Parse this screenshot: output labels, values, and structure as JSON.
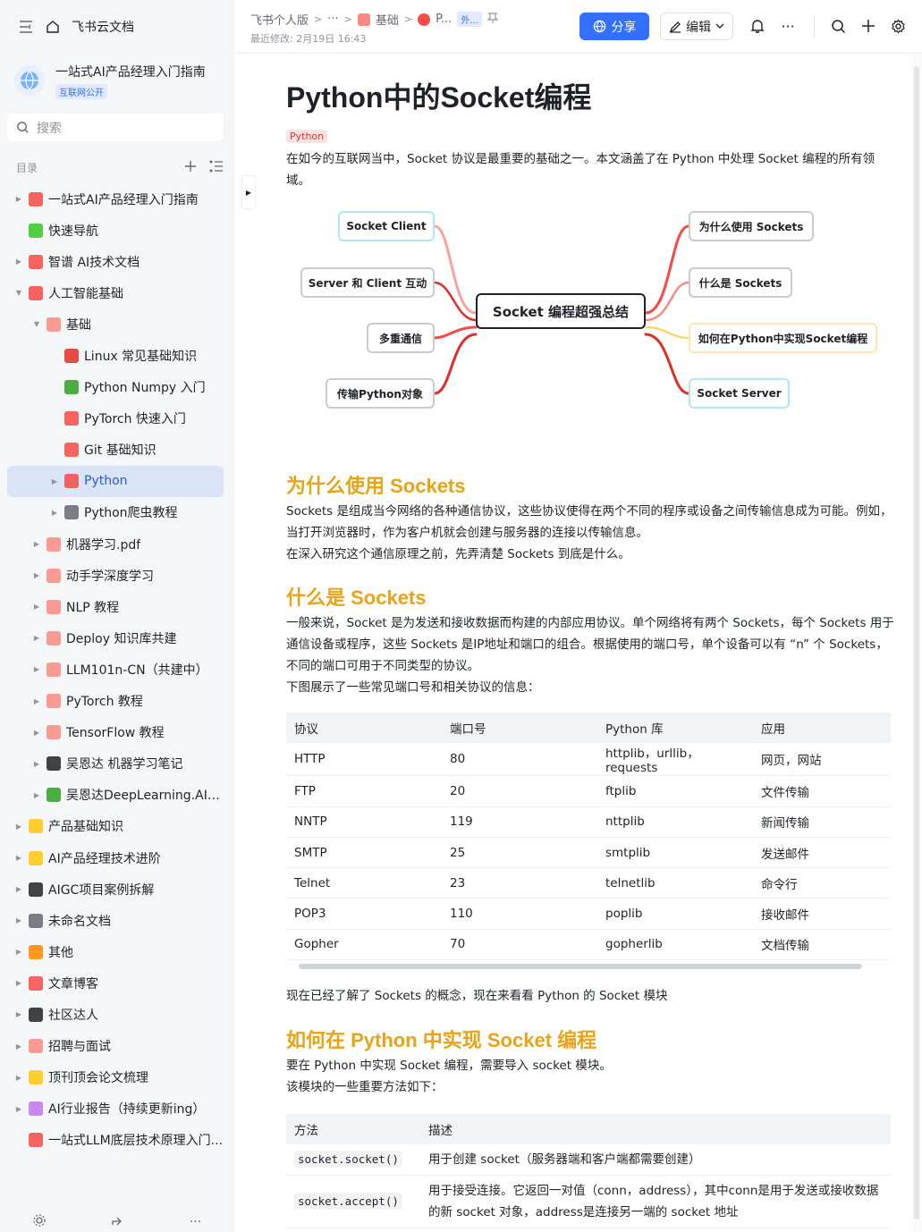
{
  "sidebar": {
    "home_label": "飞书云文档",
    "workspace_title": "一站式AI产品经理入门指南",
    "workspace_tag": "互联网公开",
    "search_placeholder": "搜索",
    "toc_label": "目录",
    "items": [
      {
        "label": "一站式AI产品经理入门指南",
        "level": 0,
        "arrow": "▶",
        "color": "#f54a45",
        "icon": "target-icon"
      },
      {
        "label": "快速导航",
        "level": 0,
        "arrow": "",
        "color": "#34c724",
        "icon": "compass-icon"
      },
      {
        "label": "智谱 AI技术文档",
        "level": 0,
        "arrow": "▶",
        "color": "#f54a45",
        "icon": "calendar-icon"
      },
      {
        "label": "人工智能基础",
        "level": 0,
        "arrow": "▼",
        "color": "#f54a45",
        "icon": "devil-icon"
      },
      {
        "label": "基础",
        "level": 1,
        "arrow": "▼",
        "color": "#f98981",
        "icon": "doc-icon"
      },
      {
        "label": "Linux 常见基础知识",
        "level": 2,
        "arrow": "",
        "color": "#e22e28",
        "icon": "apple-icon"
      },
      {
        "label": "Python Numpy 入门",
        "level": 2,
        "arrow": "",
        "color": "#2ea121",
        "icon": "refresh-icon"
      },
      {
        "label": "PyTorch 快速入门",
        "level": 2,
        "arrow": "",
        "color": "#f54a45",
        "icon": "devil-icon"
      },
      {
        "label": "Git 基础知识",
        "level": 2,
        "arrow": "",
        "color": "#f54a45",
        "icon": "devil-icon"
      },
      {
        "label": "Python",
        "level": 2,
        "arrow": "▶",
        "color": "#f54a45",
        "icon": "devil-icon",
        "active": true
      },
      {
        "label": "Python爬虫教程",
        "level": 2,
        "arrow": "▶",
        "color": "#646a73",
        "icon": "tools-icon"
      },
      {
        "label": "机器学习.pdf",
        "level": 1,
        "arrow": "▶",
        "color": "#f98981",
        "icon": "pdf-icon"
      },
      {
        "label": "动手学深度学习",
        "level": 1,
        "arrow": "▶",
        "color": "#f98981",
        "icon": "doc-icon"
      },
      {
        "label": "NLP 教程",
        "level": 1,
        "arrow": "▶",
        "color": "#f98981",
        "icon": "doc-icon"
      },
      {
        "label": "Deploy 知识库共建",
        "level": 1,
        "arrow": "▶",
        "color": "#f98981",
        "icon": "doc-icon"
      },
      {
        "label": "LLM101n-CN（共建中）",
        "level": 1,
        "arrow": "▶",
        "color": "#f98981",
        "icon": "doc-icon"
      },
      {
        "label": "PyTorch 教程",
        "level": 1,
        "arrow": "▶",
        "color": "#f98981",
        "icon": "doc-icon"
      },
      {
        "label": "TensorFlow 教程",
        "level": 1,
        "arrow": "▶",
        "color": "#f98981",
        "icon": "doc-icon"
      },
      {
        "label": "吴恩达 机器学习笔记",
        "level": 1,
        "arrow": "▶",
        "color": "#1f2329",
        "icon": "grad-cap-icon"
      },
      {
        "label": "吴恩达DeepLearning.AI课...",
        "level": 1,
        "arrow": "▶",
        "color": "#2ea121",
        "icon": "family-icon"
      },
      {
        "label": "产品基础知识",
        "level": 0,
        "arrow": "▶",
        "color": "#ffc60a",
        "icon": "banana-icon"
      },
      {
        "label": "AI产品经理技术进阶",
        "level": 0,
        "arrow": "▶",
        "color": "#ffc60a",
        "icon": "muscle-icon"
      },
      {
        "label": "AIGC项目案例拆解",
        "level": 0,
        "arrow": "▶",
        "color": "#1f2329",
        "icon": "floppy-icon"
      },
      {
        "label": "未命名文档",
        "level": 0,
        "arrow": "▶",
        "color": "#646a73",
        "icon": "doc-icon"
      },
      {
        "label": "其他",
        "level": 0,
        "arrow": "▶",
        "color": "#ff8800",
        "icon": "doc-icon"
      },
      {
        "label": "文章博客",
        "level": 0,
        "arrow": "▶",
        "color": "#f54a45",
        "icon": "calendar-icon"
      },
      {
        "label": "社区达人",
        "level": 0,
        "arrow": "▶",
        "color": "#1f2329",
        "icon": "eyes-icon"
      },
      {
        "label": "招聘与面试",
        "level": 0,
        "arrow": "▶",
        "color": "#f98981",
        "icon": "doc-icon"
      },
      {
        "label": "顶刊顶会论文梳理",
        "level": 0,
        "arrow": "▶",
        "color": "#ffc60a",
        "icon": "scroll-icon"
      },
      {
        "label": "AI行业报告（持续更新ing）",
        "level": 0,
        "arrow": "▶",
        "color": "#c174ed",
        "icon": "doc-icon"
      },
      {
        "label": "一站式LLM底层技术原理入门...",
        "level": 0,
        "arrow": "",
        "color": "#f54a45",
        "icon": "rocket-icon"
      }
    ]
  },
  "topbar": {
    "crumb_root": "飞书个人版",
    "crumb_more": "···",
    "crumb_parent": "基础",
    "crumb_current": "P...",
    "crumb_badge": "外...",
    "last_modified": "最近修改: 2月19日 16:43",
    "share_label": "分享",
    "edit_label": "编辑"
  },
  "doc": {
    "title": "Python中的Socket编程",
    "tag": "Python",
    "intro": "在如今的互联网当中，Socket 协议是最重要的基础之一。本文涵盖了在 Python 中处理 Socket 编程的所有领域。",
    "mindmap": {
      "center": "Socket 编程超强总结",
      "left": [
        "Socket Client",
        "Server 和 Client 互动",
        "多重通信",
        "传输Python对象"
      ],
      "right": [
        "为什么使用 Sockets",
        "什么是 Sockets",
        "如何在Python中实现Socket编程",
        "Socket Server"
      ]
    },
    "s1_title": "为什么使用 Sockets",
    "s1_p1": "Sockets 是组成当今网络的各种通信协议，这些协议使得在两个不同的程序或设备之间传输信息成为可能。例如，当打开浏览器时，作为客户机就会创建与服务器的连接以传输信息。",
    "s1_p2": "在深入研究这个通信原理之前，先弄清楚 Sockets 到底是什么。",
    "s2_title": "什么是 Sockets",
    "s2_p1": "一般来说，Socket 是为发送和接收数据而构建的内部应用协议。单个网络将有两个 Sockets，每个 Sockets 用于通信设备或程序，这些 Sockets 是IP地址和端口的组合。根据使用的端口号，单个设备可以有 “n” 个 Sockets，不同的端口可用于不同类型的协议。",
    "s2_p2": "下图展示了一些常见端口号和相关协议的信息：",
    "ports_table": {
      "headers": [
        "协议",
        "端口号",
        "Python 库",
        "应用"
      ],
      "rows": [
        [
          "HTTP",
          "80",
          "httplib，urllib，requests",
          "网页，网站"
        ],
        [
          "FTP",
          "20",
          "ftplib",
          "文件传输"
        ],
        [
          "NNTP",
          "119",
          "nttplib",
          "新闻传输"
        ],
        [
          "SMTP",
          "25",
          "smtplib",
          "发送邮件"
        ],
        [
          "Telnet",
          "23",
          "telnetlib",
          "命令行"
        ],
        [
          "POP3",
          "110",
          "poplib",
          "接收邮件"
        ],
        [
          "Gopher",
          "70",
          "gopherlib",
          "文档传输"
        ]
      ]
    },
    "after_table": "现在已经了解了 Sockets 的概念，现在来看看 Python 的 Socket 模块",
    "s3_title": "如何在 Python 中实现 Socket 编程",
    "s3_p1": "要在 Python 中实现 Socket 编程，需要导入 socket 模块。",
    "s3_p2": "该模块的一些重要方法如下：",
    "methods_table": {
      "headers": [
        "方法",
        "描述"
      ],
      "rows": [
        [
          "socket.socket()",
          "用于创建 socket（服务器端和客户端都需要创建）"
        ],
        [
          "socket.accept()",
          "用于接受连接。它返回一对值（conn，address），其中conn是用于发送或接收数据的新 socket 对象，address是连接另一端的 socket 地址"
        ]
      ]
    }
  }
}
